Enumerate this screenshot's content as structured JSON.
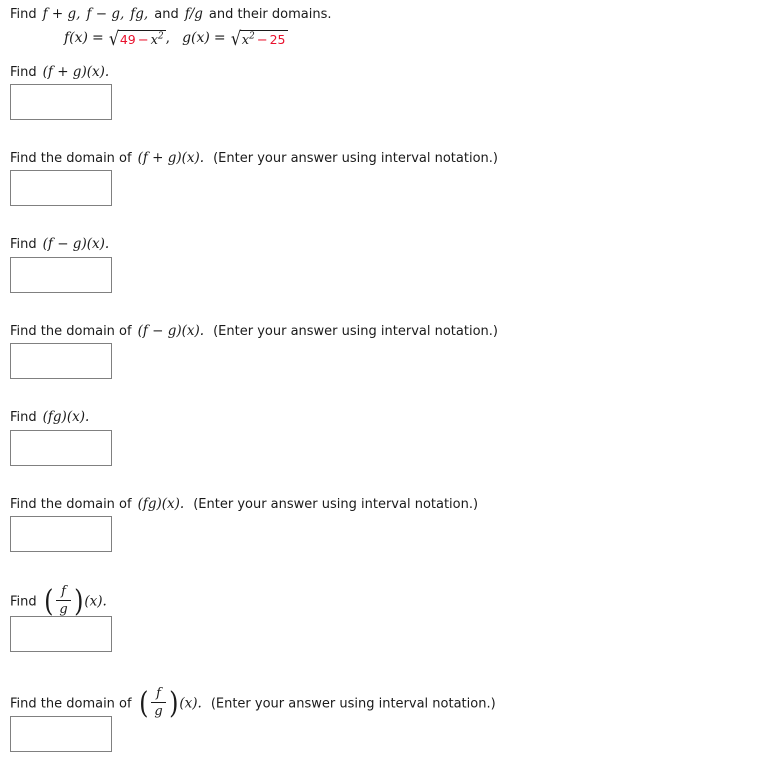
{
  "header": {
    "instruction_lead": "Find",
    "instruction_items": [
      "f + g,",
      "f − g,",
      "fg,",
      "and",
      "f/g"
    ],
    "instruction_tail": "and their domains.",
    "full_text": "Find  f + g,   f − g,   fg,  and  f/g  and their domains."
  },
  "given": {
    "f_label": "f(x)",
    "f_equals": "=",
    "f_radicand_first": "49",
    "f_radicand_operator": "−",
    "f_radicand_var": "x",
    "f_radicand_exponent": "2",
    "f_trailing": ",",
    "g_label": "g(x)",
    "g_equals": "=",
    "g_radicand_var": "x",
    "g_radicand_exponent": "2",
    "g_radicand_operator": "−",
    "g_radicand_last": "25",
    "number_color": "#e8112d",
    "text_color": "#1a1a1a"
  },
  "questions": [
    {
      "id": "sum-value",
      "lead": "Find",
      "expr_kind": "inline",
      "expr": "(f + g)(x).",
      "hint": "",
      "answer_value": "",
      "box_label": "answer-input-sum-value"
    },
    {
      "id": "sum-domain",
      "lead": "Find the domain of",
      "expr_kind": "inline",
      "expr": "(f + g)(x).",
      "hint": "(Enter your answer using interval notation.)",
      "answer_value": "",
      "box_label": "answer-input-sum-domain"
    },
    {
      "id": "difference-value",
      "lead": "Find",
      "expr_kind": "inline",
      "expr": "(f − g)(x).",
      "hint": "",
      "answer_value": "",
      "box_label": "answer-input-difference-value"
    },
    {
      "id": "difference-domain",
      "lead": "Find the domain of",
      "expr_kind": "inline",
      "expr": "(f − g)(x).",
      "hint": "(Enter your answer using interval notation.)",
      "answer_value": "",
      "box_label": "answer-input-difference-domain"
    },
    {
      "id": "product-value",
      "lead": "Find",
      "expr_kind": "inline",
      "expr": "(fg)(x).",
      "hint": "",
      "answer_value": "",
      "box_label": "answer-input-product-value"
    },
    {
      "id": "product-domain",
      "lead": "Find the domain of",
      "expr_kind": "inline",
      "expr": "(fg)(x).",
      "hint": "(Enter your answer using interval notation.)",
      "answer_value": "",
      "box_label": "answer-input-product-domain"
    },
    {
      "id": "quotient-value",
      "lead": "Find",
      "expr_kind": "fraction",
      "numerator": "f",
      "denominator": "g",
      "expr_suffix": "(x).",
      "hint": "",
      "answer_value": "",
      "box_label": "answer-input-quotient-value"
    },
    {
      "id": "quotient-domain",
      "lead": "Find the domain of",
      "expr_kind": "fraction",
      "numerator": "f",
      "denominator": "g",
      "expr_suffix": "(x).",
      "hint": "(Enter your answer using interval notation.)",
      "answer_value": "",
      "box_label": "answer-input-quotient-domain"
    }
  ]
}
